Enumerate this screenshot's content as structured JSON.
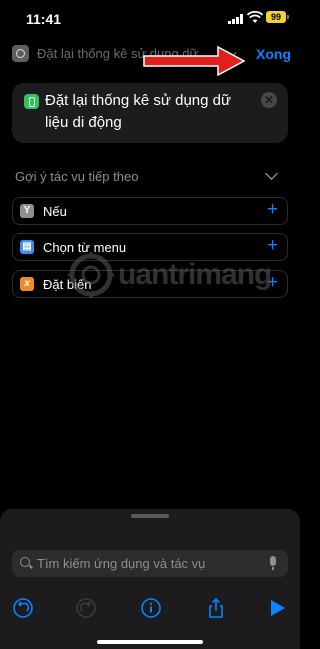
{
  "status_bar": {
    "time": "11:41",
    "battery": "99"
  },
  "nav": {
    "title": "Đặt lại thống kê sử dụng dữ liệu di động",
    "done_label": "Xong"
  },
  "action": {
    "text": "Đặt lại thống kê sử dụng dữ liệu di động",
    "icon": "antenna-icon",
    "icon_color": "#32c45a"
  },
  "suggestions": {
    "header": "Gợi ý tác vụ tiếp theo",
    "items": [
      {
        "label": "Nếu",
        "icon": "if-icon",
        "icon_color": "#8e8e93",
        "glyph": "Y"
      },
      {
        "label": "Chọn từ menu",
        "icon": "menu-icon",
        "icon_color": "#3d8ef0",
        "glyph": "▤"
      },
      {
        "label": "Đặt biến",
        "icon": "variable-icon",
        "icon_color": "#f08a24",
        "glyph": "x"
      }
    ]
  },
  "watermark": {
    "text": "uantrimang"
  },
  "bottom": {
    "search_placeholder": "Tìm kiếm ứng dụng và tác vụ"
  },
  "colors": {
    "accent": "#0a84ff",
    "annotation_arrow": "#e0201c",
    "background": "#000000"
  }
}
